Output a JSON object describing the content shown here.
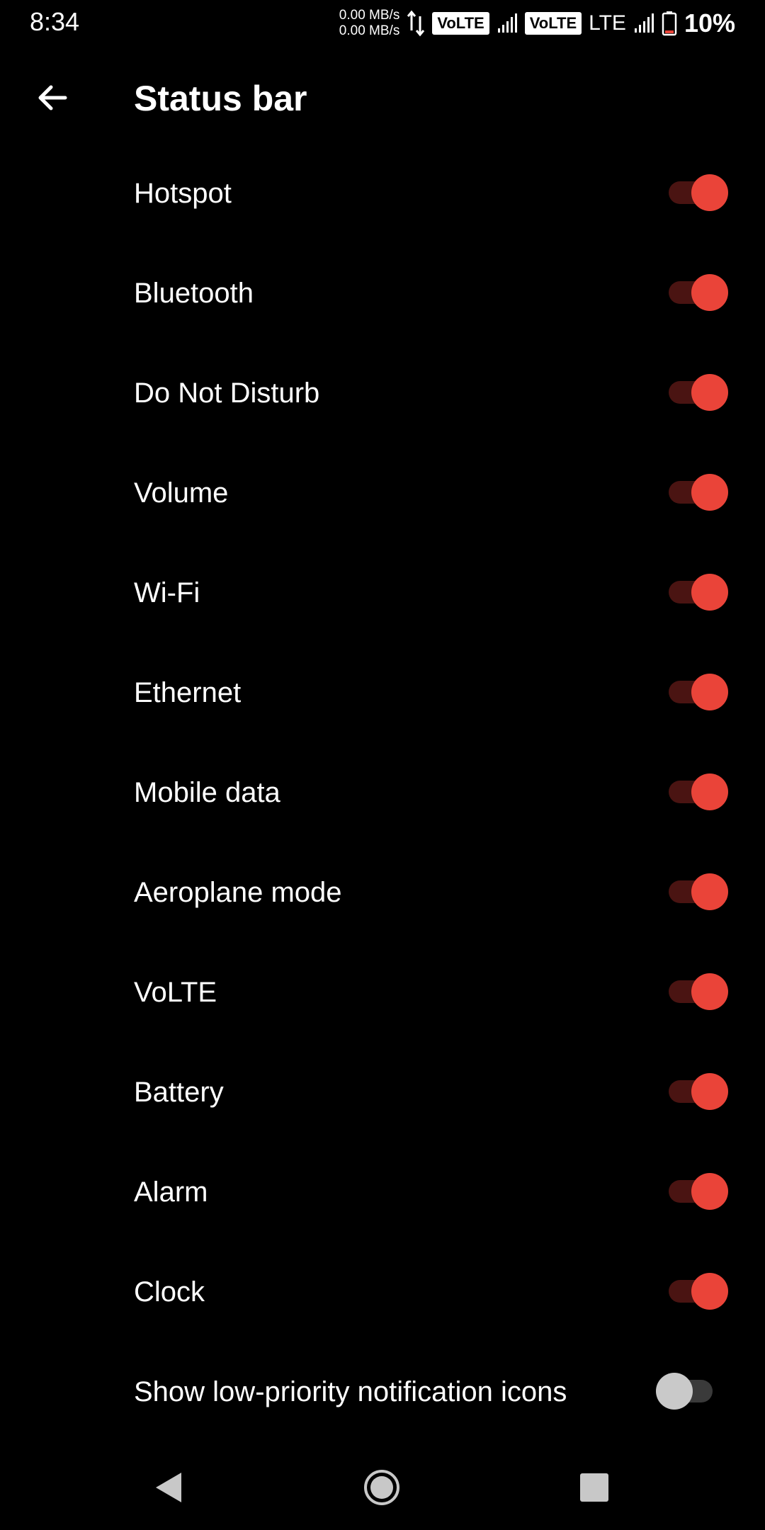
{
  "status_bar": {
    "time": "8:34",
    "net_up": "0.00 MB/s",
    "net_down": "0.00 MB/s",
    "sim1_badge": "VoLTE",
    "sim2_badge": "VoLTE",
    "sim2_network": "LTE",
    "battery_percent": "10%",
    "icons": [
      "data-arrows-icon",
      "signal-icon",
      "signal-icon",
      "battery-icon"
    ]
  },
  "header": {
    "back_icon": "arrow-left-icon",
    "title": "Status bar"
  },
  "settings": [
    {
      "label": "Hotspot",
      "enabled": true
    },
    {
      "label": "Bluetooth",
      "enabled": true
    },
    {
      "label": "Do Not Disturb",
      "enabled": true
    },
    {
      "label": "Volume",
      "enabled": true
    },
    {
      "label": "Wi-Fi",
      "enabled": true
    },
    {
      "label": "Ethernet",
      "enabled": true
    },
    {
      "label": "Mobile data",
      "enabled": true
    },
    {
      "label": "Aeroplane mode",
      "enabled": true
    },
    {
      "label": "VoLTE",
      "enabled": true
    },
    {
      "label": "Battery",
      "enabled": true
    },
    {
      "label": "Alarm",
      "enabled": true
    },
    {
      "label": "Clock",
      "enabled": true
    },
    {
      "label": "Show low-priority notification icons",
      "enabled": false
    }
  ],
  "nav_bar": {
    "icons": [
      "nav-back-icon",
      "nav-home-icon",
      "nav-recents-icon"
    ]
  },
  "colors": {
    "background": "#000000",
    "accent": "#ea4439",
    "track_on": "#4a1412",
    "thumb_off": "#c9c9c9",
    "track_off": "#3a3a3a"
  }
}
